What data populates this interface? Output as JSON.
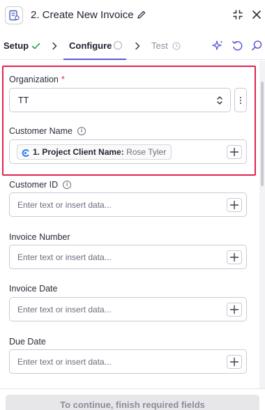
{
  "header": {
    "title": "2. Create New Invoice",
    "icons": {
      "app": "invoice-app-icon",
      "edit": "pencil-icon",
      "collapse": "collapse-icon",
      "close": "close-icon"
    }
  },
  "tabs": [
    {
      "label": "Setup",
      "status": "complete"
    },
    {
      "label": "Configure",
      "status": "incomplete",
      "active": true
    },
    {
      "label": "Test",
      "status": "pending"
    }
  ],
  "colors": {
    "accent": "#5b5bd6",
    "required": "#e0234e",
    "highlight": "#e0234e",
    "success": "#17a34a"
  },
  "form": {
    "organization": {
      "label": "Organization",
      "required_mark": "*",
      "value": "TT"
    },
    "customer_name": {
      "label": "Customer Name",
      "chip_step": "1. Project Client Name:",
      "chip_value": "Rose Tyler"
    },
    "customer_id": {
      "label": "Customer ID",
      "placeholder": "Enter text or insert data..."
    },
    "invoice_number": {
      "label": "Invoice Number",
      "placeholder": "Enter text or insert data..."
    },
    "invoice_date": {
      "label": "Invoice Date",
      "placeholder": "Enter text or insert data..."
    },
    "due_date": {
      "label": "Due Date",
      "placeholder": "Enter text or insert data..."
    }
  },
  "footer": {
    "continue_label": "To continue, finish required fields"
  }
}
